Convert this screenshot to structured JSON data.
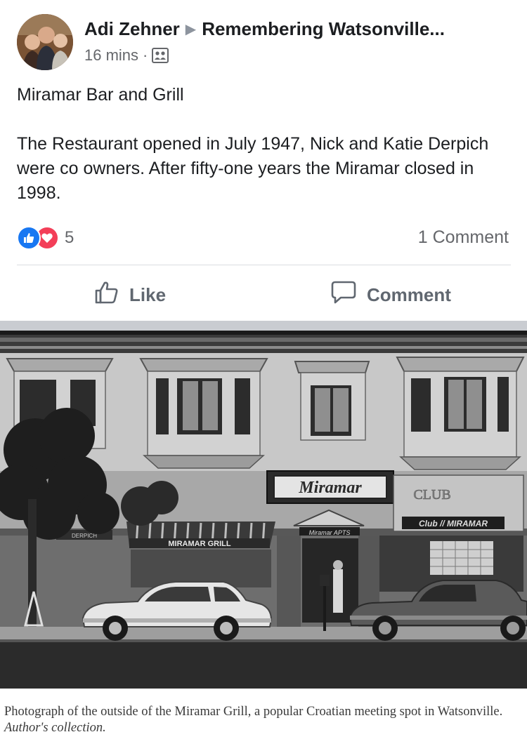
{
  "post": {
    "author": "Adi Zehner",
    "group": "Remembering Watsonville...",
    "time": "16 mins",
    "separator": "·",
    "privacy_icon": "group-icon",
    "title": "Miramar Bar and Grill",
    "body": "The Restaurant opened in July 1947, Nick and Katie Derpich were co owners.  After  fifty-one years the Miramar closed in 1998."
  },
  "reactions": {
    "count": "5",
    "types": [
      "like-icon",
      "love-icon"
    ],
    "comments_label": "1 Comment"
  },
  "actions": {
    "like_label": "Like",
    "comment_label": "Comment"
  },
  "photo": {
    "sign_main": "Miramar",
    "sign_grill": "MIRAMAR GRILL",
    "sign_club": "CLUB",
    "sign_club_miramar": "Club // MIRAMAR",
    "sign_apts": "Miramar APTS",
    "sign_derp": "DERPICH",
    "caption_main": "Photograph of the outside of the Miramar Grill, a popular Croatian meeting spot in Watsonville. ",
    "caption_credit": "Author's collection."
  },
  "colors": {
    "link_blue": "#1877f2",
    "love_red": "#f33e58",
    "text_secondary": "#65676b"
  }
}
